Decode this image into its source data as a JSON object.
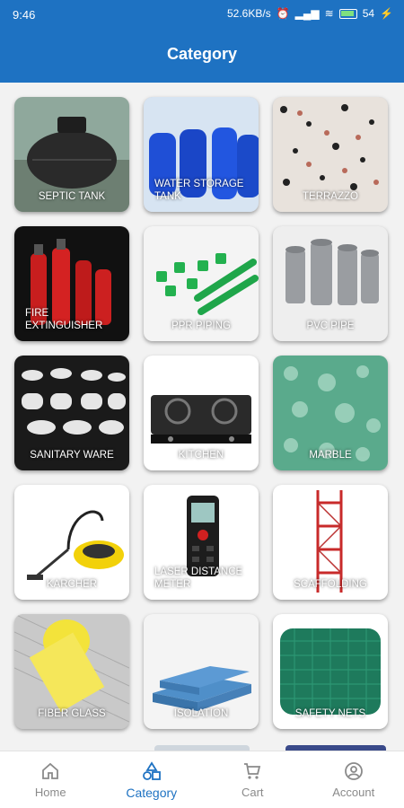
{
  "status_bar": {
    "time": "9:46",
    "network_speed": "52.6KB/s",
    "battery": "54"
  },
  "header": {
    "title": "Category"
  },
  "categories": [
    {
      "label": "SEPTIC TANK"
    },
    {
      "label": "WATER STORAGE TANK"
    },
    {
      "label": "TERRAZZO"
    },
    {
      "label": "FIRE EXTINGUISHER"
    },
    {
      "label": "PPR PIPING"
    },
    {
      "label": "PVC PIPE"
    },
    {
      "label": "SANITARY WARE"
    },
    {
      "label": "KITCHEN"
    },
    {
      "label": "MARBLE"
    },
    {
      "label": "KARCHER"
    },
    {
      "label": "LASER DISTANCE METER"
    },
    {
      "label": "SCAFFOLDING"
    },
    {
      "label": "FIBER GLASS"
    },
    {
      "label": "ISOLATION"
    },
    {
      "label": "SAFETY NETS"
    }
  ],
  "bottom_nav": {
    "items": [
      {
        "label": "Home",
        "icon": "home-icon"
      },
      {
        "label": "Category",
        "icon": "category-icon"
      },
      {
        "label": "Cart",
        "icon": "cart-icon"
      },
      {
        "label": "Account",
        "icon": "account-icon"
      }
    ],
    "active": "Category"
  },
  "colors": {
    "primary": "#1e72c2",
    "inactive": "#8a8a8a"
  }
}
